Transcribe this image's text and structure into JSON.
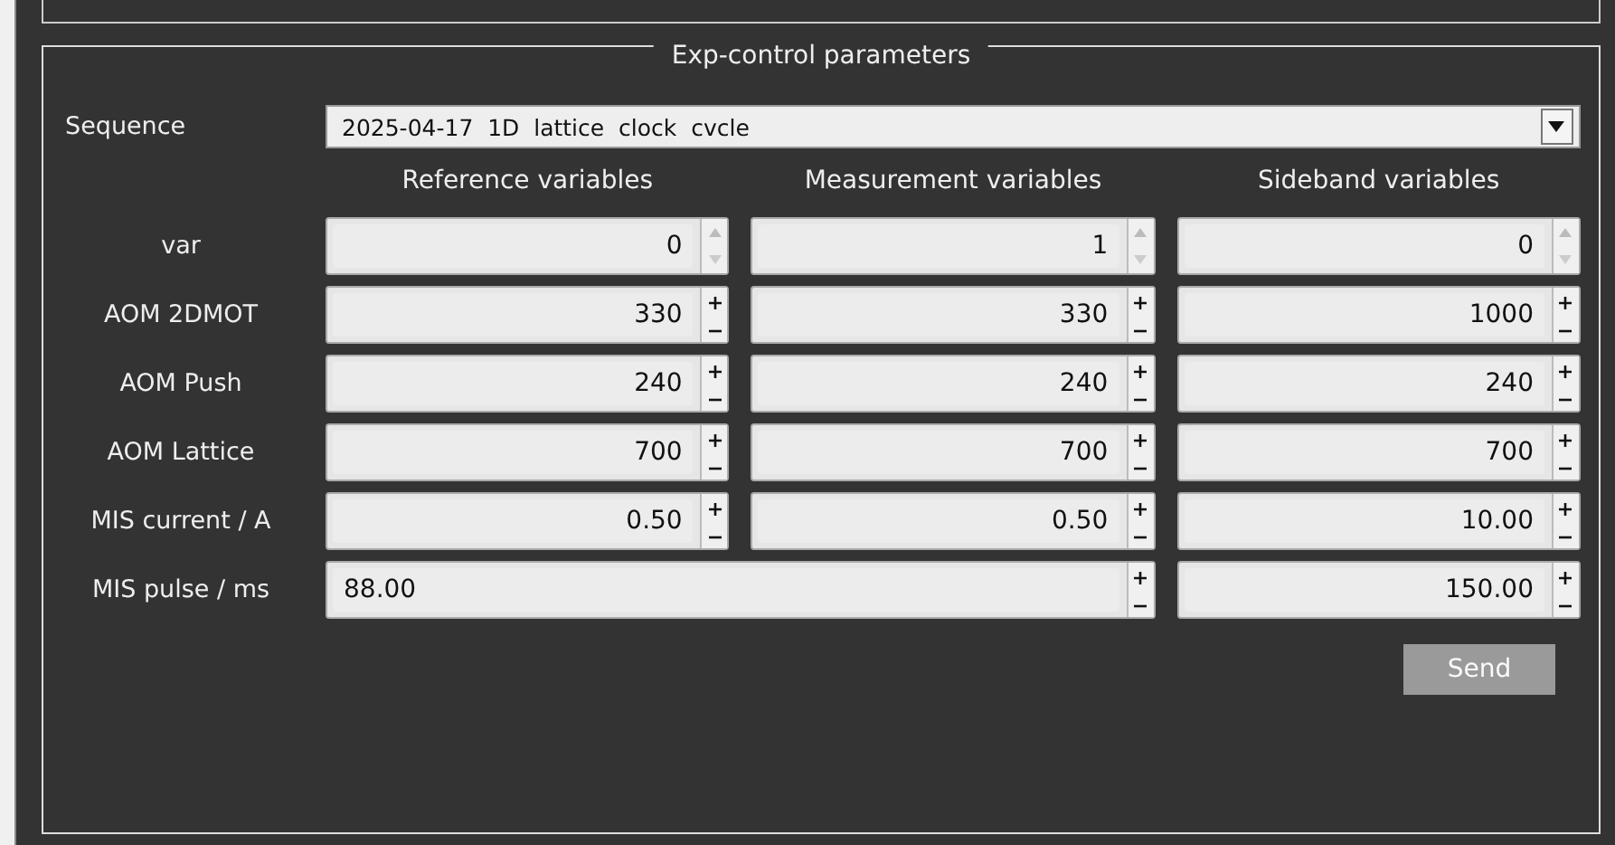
{
  "group": {
    "title": "Exp-control parameters"
  },
  "sequence": {
    "label": "Sequence",
    "value": "2025-04-17  1D  lattice  clock  cvcle"
  },
  "columns": [
    "Reference variables",
    "Measurement variables",
    "Sideband variables"
  ],
  "rows": [
    {
      "label": "var",
      "kind": "arrows",
      "cells": [
        "0",
        "1",
        "0"
      ]
    },
    {
      "label": "AOM 2DMOT",
      "kind": "plusminus",
      "cells": [
        "330",
        "330",
        "1000"
      ]
    },
    {
      "label": "AOM Push",
      "kind": "plusminus",
      "cells": [
        "240",
        "240",
        "240"
      ]
    },
    {
      "label": "AOM Lattice",
      "kind": "plusminus",
      "cells": [
        "700",
        "700",
        "700"
      ]
    },
    {
      "label": "MIS current / A",
      "kind": "plusminus",
      "cells": [
        "0.50",
        "0.50",
        "10.00"
      ]
    },
    {
      "label": "MIS pulse / ms",
      "kind": "plusminus",
      "cells": [
        "88.00",
        "150.00"
      ]
    }
  ],
  "send_button": {
    "label": "Send",
    "disabled": true
  }
}
